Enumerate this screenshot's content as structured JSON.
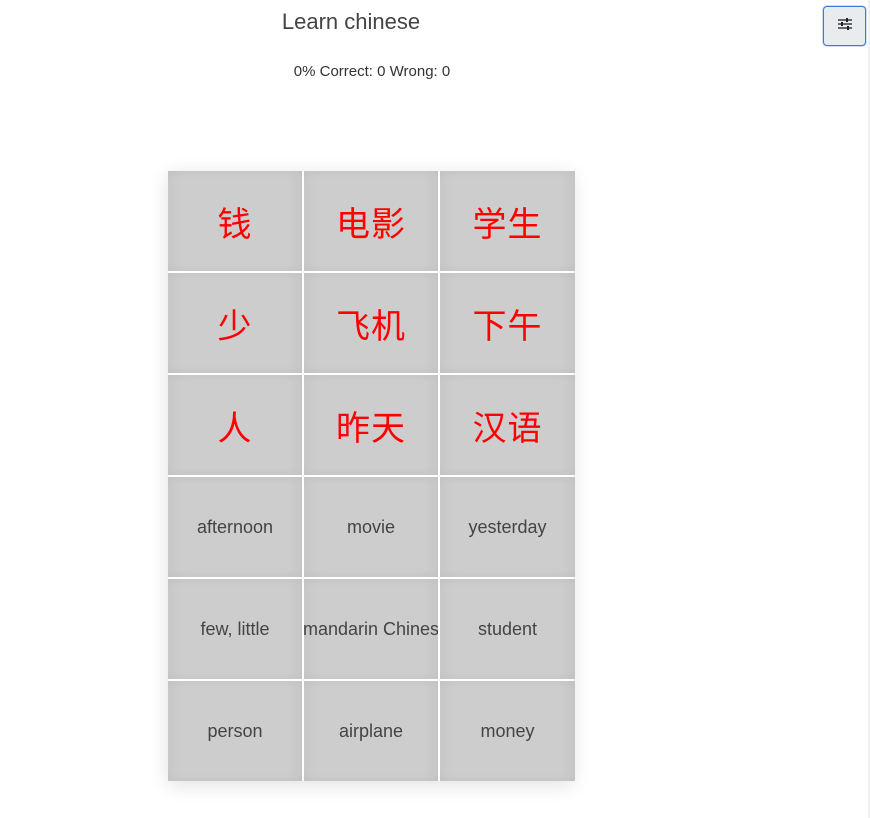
{
  "header": {
    "title": "Learn chinese",
    "percent": "0%",
    "correct_label": "Correct:",
    "correct_value": "0",
    "wrong_label": "Wrong:",
    "wrong_value": "0"
  },
  "settings_button": {
    "icon": "sliders-icon"
  },
  "grid": {
    "hanzi_tiles": [
      "钱",
      "电影",
      "学生",
      "少",
      "飞机",
      "下午",
      "人",
      "昨天",
      "汉语"
    ],
    "english_tiles": [
      "afternoon",
      "movie",
      "yesterday",
      "few, little",
      "mandarin Chines",
      "student",
      "person",
      "airplane",
      "money"
    ]
  },
  "colors": {
    "hanzi_text": "#ff0000",
    "tile_background": "#cdcdcd",
    "button_border": "#3b7bd4"
  }
}
